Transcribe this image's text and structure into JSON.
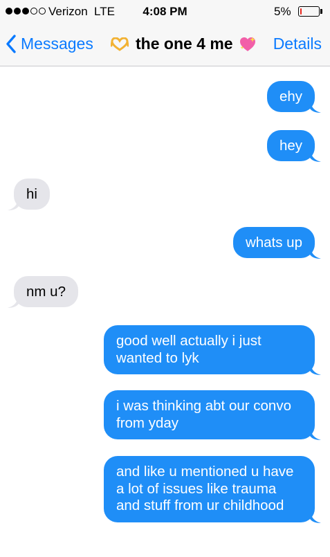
{
  "status_bar": {
    "carrier": "Verizon",
    "network": "LTE",
    "time": "4:08 PM",
    "battery": "5%",
    "battery_level": 0.05,
    "signal_bars_filled": 3,
    "signal_bars_total": 5
  },
  "nav": {
    "back_label": "Messages",
    "title": "the one 4 me",
    "left_emoji": "heart-hands-emoji",
    "right_emoji": "sparkling-heart-emoji",
    "details_label": "Details"
  },
  "colors": {
    "sent_bubble": "#1f8ef7",
    "received_bubble": "#e5e5ea",
    "accent": "#0a7aff"
  },
  "messages": [
    {
      "direction": "sent",
      "text": "ehy"
    },
    {
      "direction": "sent",
      "text": "hey"
    },
    {
      "direction": "received",
      "text": "hi"
    },
    {
      "direction": "sent",
      "text": "whats up"
    },
    {
      "direction": "received",
      "text": "nm u?"
    },
    {
      "direction": "sent",
      "text": "good well actually i just wanted to lyk"
    },
    {
      "direction": "sent",
      "text": "i was thinking abt our convo from yday"
    },
    {
      "direction": "sent",
      "text": "and like u mentioned u have a lot of issues like trauma and stuff from ur childhood"
    }
  ]
}
